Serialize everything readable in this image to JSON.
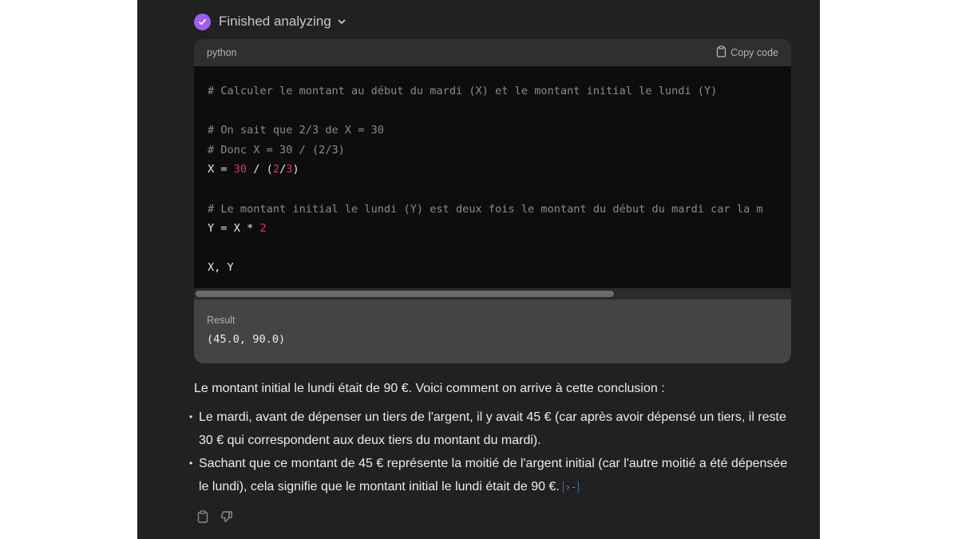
{
  "status": {
    "label": "Finished analyzing",
    "icon": "check-circle-icon",
    "accent_color": "#a15cf0"
  },
  "code_block": {
    "language": "python",
    "copy_label": "Copy code",
    "lines": [
      {
        "type": "comment",
        "text": "# Calculer le montant au début du mardi (X) et le montant initial le lundi (Y)"
      },
      {
        "type": "blank",
        "text": ""
      },
      {
        "type": "comment",
        "text": "# On sait que 2/3 de X = 30"
      },
      {
        "type": "comment",
        "text": "# Donc X = 30 / (2/3)"
      },
      {
        "type": "code",
        "tokens": [
          {
            "t": "X = ",
            "k": "plain"
          },
          {
            "t": "30",
            "k": "num"
          },
          {
            "t": " / (",
            "k": "plain"
          },
          {
            "t": "2",
            "k": "num"
          },
          {
            "t": "/",
            "k": "plain"
          },
          {
            "t": "3",
            "k": "num"
          },
          {
            "t": ")",
            "k": "plain"
          }
        ]
      },
      {
        "type": "blank",
        "text": ""
      },
      {
        "type": "comment",
        "text": "# Le montant initial le lundi (Y) est deux fois le montant du début du mardi car la m"
      },
      {
        "type": "code",
        "tokens": [
          {
            "t": "Y = X * ",
            "k": "plain"
          },
          {
            "t": "2",
            "k": "num"
          }
        ]
      },
      {
        "type": "blank",
        "text": ""
      },
      {
        "type": "code",
        "tokens": [
          {
            "t": "X, Y",
            "k": "plain"
          }
        ]
      }
    ],
    "number_color": "#df3079",
    "horizontal_scroll_fraction_visible": 0.7
  },
  "result": {
    "label": "Result",
    "value": "(45.0, 90.0)"
  },
  "answer": {
    "intro": "Le montant initial le lundi était de 90 €. Voici comment on arrive à cette conclusion :",
    "points": [
      "Le mardi, avant de dépenser un tiers de l'argent, il y avait 45 € (car après avoir dépensé un tiers, il reste 30 € qui correspondent aux deux tiers du montant du mardi).",
      "Sachant que ce montant de 45 € représente la moitié de l'argent initial (car l'autre moitié a été dépensée le lundi), cela signifie que le montant initial le lundi était de 90 €."
    ],
    "citation_label": "[>_]",
    "citation_glyph": "›-"
  },
  "actions": {
    "copy": "copy-icon",
    "dislike": "thumbs-down-icon"
  }
}
